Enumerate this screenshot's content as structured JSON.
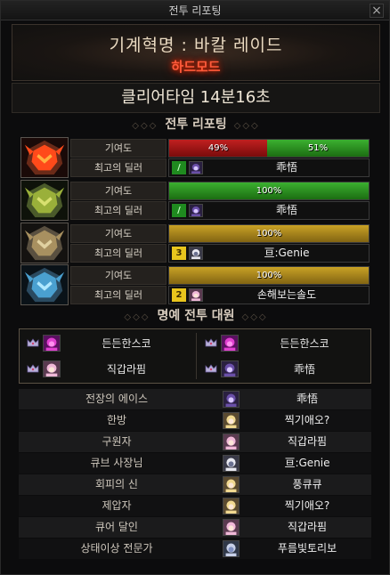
{
  "window": {
    "title": "전투 리포팅",
    "close_symbol": "×"
  },
  "raid": {
    "name": "기계혁명 : 바칼 레이드",
    "mode": "하드모드"
  },
  "clear_time": "클리어타임  14분16초",
  "sections": {
    "battle_report": "전투 리포팅",
    "party": "명예 전투 대원",
    "deco_left": "◇◇◇",
    "deco_right": "◇◇◇"
  },
  "labels": {
    "contribution": "기여도",
    "best_dealer": "최고의 딜러"
  },
  "bosses": [
    {
      "name_icon": "boss-red-helmet-icon",
      "contribution": [
        {
          "percent": "49%",
          "fraction": 0.49,
          "color": "red"
        },
        {
          "percent": "51%",
          "fraction": 0.51,
          "color": "green"
        }
      ],
      "dealer": {
        "rank": "/",
        "rank_color": "green",
        "char_icon": "dark-mage-avatar-icon",
        "name": "乖悟"
      }
    },
    {
      "name_icon": "boss-green-helmet-icon",
      "contribution": [
        {
          "percent": "100%",
          "fraction": 1.0,
          "color": "green"
        }
      ],
      "dealer": {
        "rank": "/",
        "rank_color": "green",
        "char_icon": "dark-mage-avatar-icon",
        "name": "乖悟"
      }
    },
    {
      "name_icon": "boss-gold-helmet-icon",
      "contribution": [
        {
          "percent": "100%",
          "fraction": 1.0,
          "color": "gold"
        }
      ],
      "dealer": {
        "rank": "3",
        "rank_color": "yellow",
        "char_icon": "white-hair-avatar-icon",
        "name": "亘:Genie"
      }
    },
    {
      "name_icon": "boss-blue-helmet-icon",
      "contribution": [
        {
          "percent": "100%",
          "fraction": 1.0,
          "color": "gold"
        }
      ],
      "dealer": {
        "rank": "2",
        "rank_color": "yellow",
        "char_icon": "pink-hair-avatar-icon",
        "name": "손해보는솔도"
      }
    }
  ],
  "party": [
    {
      "name": "든든한스코",
      "char_icon": "magenta-creature-avatar-icon"
    },
    {
      "name": "든든한스코",
      "char_icon": "magenta-creature-avatar-icon"
    },
    {
      "name": "직갑라핌",
      "char_icon": "pink-hair-avatar-icon"
    },
    {
      "name": "乖悟",
      "char_icon": "dark-mage-avatar-icon"
    }
  ],
  "awards": [
    {
      "title": "전장의 에이스",
      "name": "乖悟",
      "char_icon": "dark-mage-avatar-icon"
    },
    {
      "title": "한방",
      "name": "찍기애오?",
      "char_icon": "blonde-avatar-icon"
    },
    {
      "title": "구원자",
      "name": "직갑라핌",
      "char_icon": "pink-hair-avatar-icon"
    },
    {
      "title": "큐브 사장님",
      "name": "亘:Genie",
      "char_icon": "white-hair-avatar-icon"
    },
    {
      "title": "회피의 신",
      "name": "풍큐큐",
      "char_icon": "blonde-avatar-icon"
    },
    {
      "title": "제압자",
      "name": "찍기애오?",
      "char_icon": "blonde-avatar-icon"
    },
    {
      "title": "큐어 달인",
      "name": "직갑라핌",
      "char_icon": "pink-hair-avatar-icon"
    },
    {
      "title": "상태이상 전문가",
      "name": "푸름빛토리보",
      "char_icon": "silver-hair-avatar-icon"
    }
  ],
  "colors": {
    "contribution_red": "#a01818",
    "contribution_green": "#2a9a22",
    "contribution_gold": "#b08c1d",
    "mode_text": "#ff5a3a"
  }
}
